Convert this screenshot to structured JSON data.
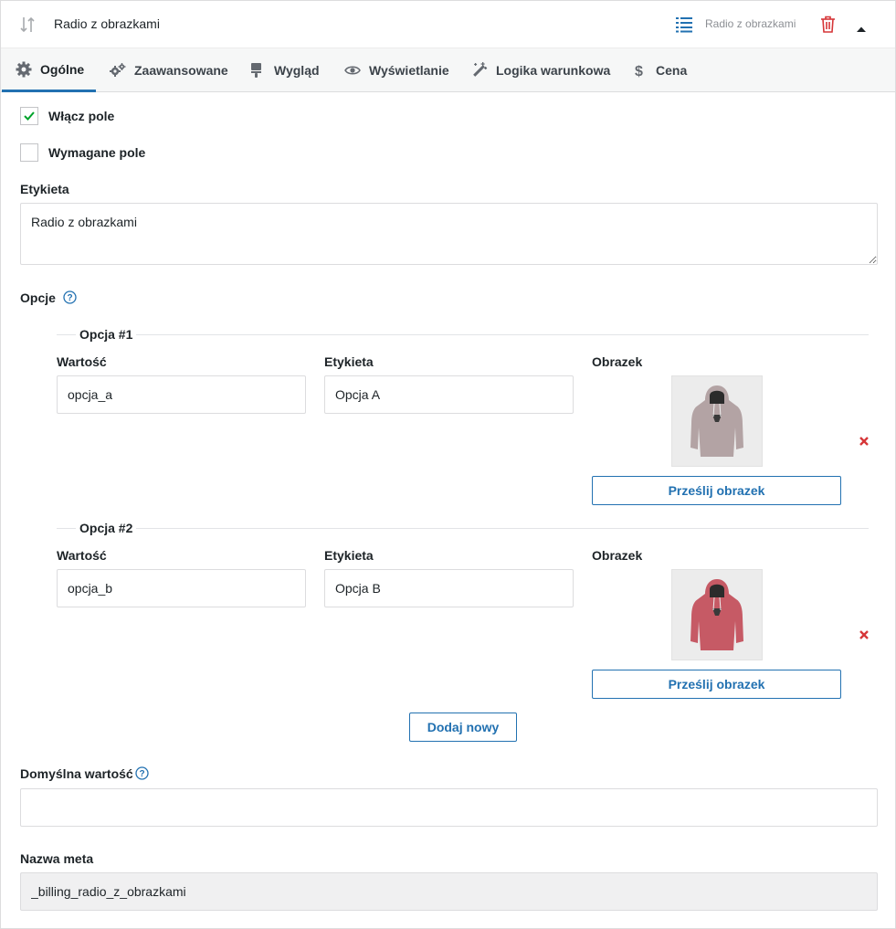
{
  "header": {
    "title": "Radio z obrazkami",
    "field_type": "Radio z obrazkami"
  },
  "tabs": [
    {
      "label": "Ogólne",
      "icon": "gear-icon",
      "active": true
    },
    {
      "label": "Zaawansowane",
      "icon": "gears-icon",
      "active": false
    },
    {
      "label": "Wygląd",
      "icon": "brush-icon",
      "active": false
    },
    {
      "label": "Wyświetlanie",
      "icon": "eye-icon",
      "active": false
    },
    {
      "label": "Logika warunkowa",
      "icon": "magic-wand-icon",
      "active": false
    },
    {
      "label": "Cena",
      "icon": "dollar-icon",
      "active": false
    }
  ],
  "general": {
    "enable_field": {
      "label": "Włącz pole",
      "checked": true
    },
    "required_field": {
      "label": "Wymagane pole",
      "checked": false
    },
    "label_field": {
      "label": "Etykieta",
      "value": "Radio z obrazkami"
    },
    "options_label": "Opcje",
    "options": [
      {
        "legend": "Opcja #1",
        "value_label": "Wartość",
        "value": "opcja_a",
        "label_label": "Etykieta",
        "label": "Opcja A",
        "image_label": "Obrazek",
        "image_color": "#b3a3a4",
        "upload_label": "Prześlij obrazek"
      },
      {
        "legend": "Opcja #2",
        "value_label": "Wartość",
        "value": "opcja_b",
        "label_label": "Etykieta",
        "label": "Opcja B",
        "image_label": "Obrazek",
        "image_color": "#c65a65",
        "upload_label": "Prześlij obrazek"
      }
    ],
    "add_new_label": "Dodaj nowy",
    "default_value": {
      "label": "Domyślna wartość",
      "value": ""
    },
    "meta_name": {
      "label": "Nazwa meta",
      "value": "_billing_radio_z_obrazkami"
    }
  },
  "colors": {
    "accent": "#2271b1",
    "danger": "#d63638",
    "check": "#00a32a"
  }
}
